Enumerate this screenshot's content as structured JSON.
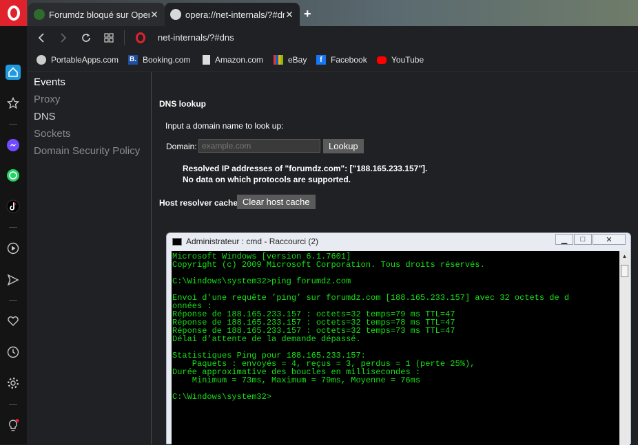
{
  "browser": {
    "tabs": [
      {
        "label": "Forumdz bloqué sur Opera",
        "favicon_color": "#2f6b2f"
      },
      {
        "label": "opera://net-internals/?#dns",
        "favicon_color": "#d8d8d8"
      }
    ],
    "new_tab_label": "+",
    "address": "net-internals/?#dns",
    "bookmarks": [
      {
        "label": "PortableApps.com",
        "icon": "portableapps-icon",
        "color": "#cccccc"
      },
      {
        "label": "Booking.com",
        "icon": "booking-icon",
        "color": "#1f4ea1"
      },
      {
        "label": "Amazon.com",
        "icon": "document-icon",
        "color": "#dddddd"
      },
      {
        "label": "eBay",
        "icon": "ebay-icon",
        "color": "#e53238"
      },
      {
        "label": "Facebook",
        "icon": "facebook-icon",
        "color": "#1877f2"
      },
      {
        "label": "YouTube",
        "icon": "youtube-icon",
        "color": "#ff0000"
      }
    ]
  },
  "sidebar_icons": [
    "home-icon",
    "star-icon",
    "messenger-icon",
    "whatsapp-icon",
    "tiktok-icon",
    "player-icon",
    "send-icon",
    "heart-icon",
    "history-icon",
    "settings-icon",
    "lightbulb-icon"
  ],
  "nav": {
    "items": [
      "Events",
      "Proxy",
      "DNS",
      "Sockets",
      "Domain Security Policy"
    ]
  },
  "dns": {
    "heading": "DNS lookup",
    "prompt": "Input a domain name to look up:",
    "domain_label": "Domain:",
    "domain_placeholder": "example.com",
    "lookup_button": "Lookup",
    "resolved_line1": "Resolved IP addresses of \"forumdz.com\": [\"188.165.233.157\"].",
    "resolved_line2": "No data on which protocols are supported.",
    "host_cache_label": "Host resolver cache",
    "clear_cache_button": "Clear host cache"
  },
  "cmd": {
    "title": "Administrateur : cmd - Raccourci (2)",
    "minimize": "▁",
    "maximize": "□",
    "close": "✕",
    "text": "Microsoft Windows [version 6.1.7601]\nCopyright (c) 2009 Microsoft Corporation. Tous droits réservés.\n\nC:\\Windows\\system32>ping forumdz.com\n\nEnvoi d’une requête ’ping’ sur forumdz.com [188.165.233.157] avec 32 octets de d\nonnées :\nRéponse de 188.165.233.157 : octets=32 temps=79 ms TTL=47\nRéponse de 188.165.233.157 : octets=32 temps=78 ms TTL=47\nRéponse de 188.165.233.157 : octets=32 temps=73 ms TTL=47\nDélai d’attente de la demande dépassé.\n\nStatistiques Ping pour 188.165.233.157:\n    Paquets : envoyés = 4, reçus = 3, perdus = 1 (perte 25%),\nDurée approximative des boucles en millisecondes :\n    Minimum = 73ms, Maximum = 79ms, Moyenne = 76ms\n\nC:\\Windows\\system32>"
  }
}
